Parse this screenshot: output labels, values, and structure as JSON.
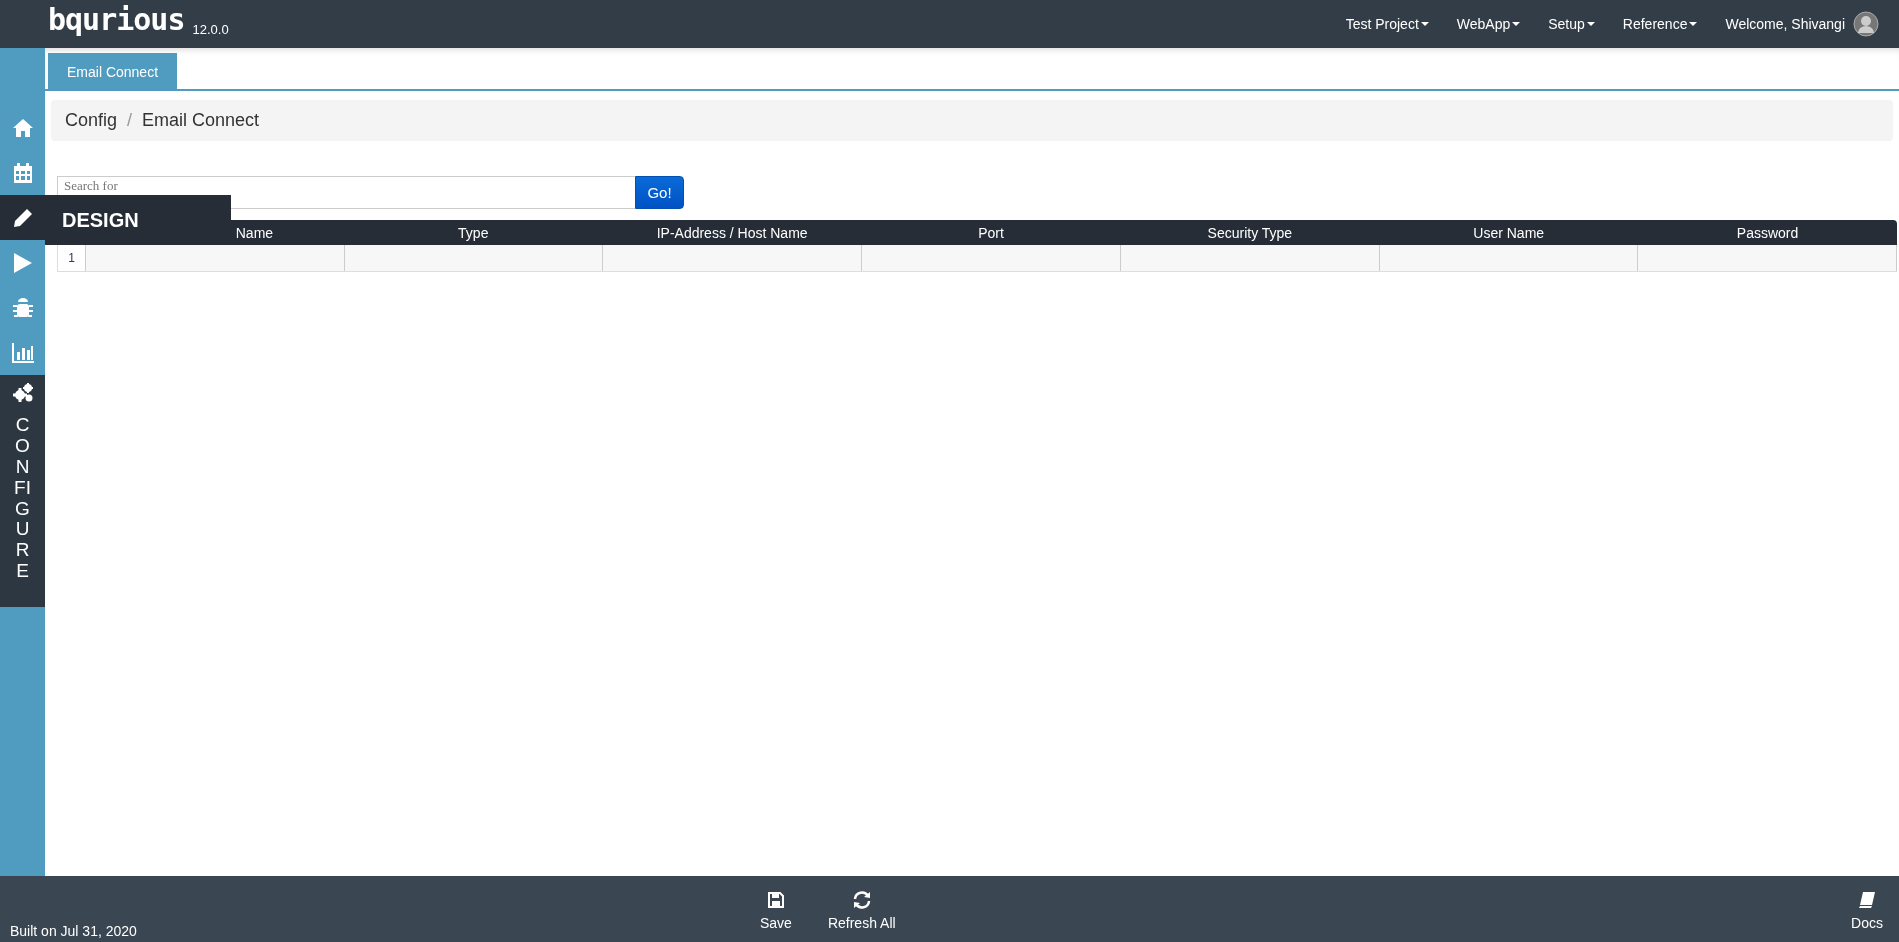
{
  "topbar": {
    "logo": "bqurious",
    "version": "12.0.0",
    "menus": [
      {
        "label": "Test Project"
      },
      {
        "label": "WebApp"
      },
      {
        "label": "Setup"
      },
      {
        "label": "Reference"
      }
    ],
    "user": "Welcome, Shivangi"
  },
  "sidebar": {
    "items": [
      {
        "kind": "home",
        "selected": false
      },
      {
        "kind": "calendar",
        "selected": false
      },
      {
        "kind": "design",
        "selected": false,
        "hovered": true,
        "tooltip": "DESIGN"
      },
      {
        "kind": "run",
        "selected": false
      },
      {
        "kind": "bug",
        "selected": false
      },
      {
        "kind": "chart",
        "selected": false
      },
      {
        "kind": "configure",
        "selected": true,
        "label": "CONFIGURE"
      }
    ]
  },
  "tabs": [
    {
      "label": "Email Connect",
      "selected": true
    }
  ],
  "breadcrumb": {
    "items": [
      "Config",
      "Email Connect"
    ],
    "separator": "/"
  },
  "search": {
    "placeholder": "Search for",
    "button": "Go!"
  },
  "table": {
    "columns": [
      "Name",
      "Type",
      "IP-Address / Host Name",
      "Port",
      "Security Type",
      "User Name",
      "Password"
    ],
    "rows": [
      {
        "number": "1"
      }
    ]
  },
  "footer": {
    "built": "Built on Jul 31, 2020",
    "actions": [
      {
        "kind": "save",
        "label": "Save"
      },
      {
        "kind": "refresh",
        "label": "Refresh All"
      }
    ],
    "docs": "Docs"
  }
}
